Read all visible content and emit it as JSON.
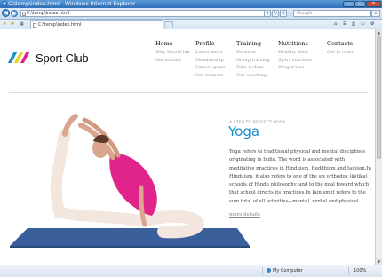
{
  "window": {
    "title": "C:\\temp\\index.html - Windows Internet Explorer",
    "minimize": "–",
    "maximize": "□",
    "close": "✕"
  },
  "addressbar": {
    "url": "C:\\temp\\index.html",
    "search_placeholder": "Google",
    "back": "◀",
    "forward": "▶"
  },
  "tabs": [
    {
      "label": "C:\\temp\\index.html"
    }
  ],
  "site": {
    "logo_text": "Sport Club",
    "logo_colors": [
      "#1a8fc9",
      "#e5d21c",
      "#e0248c"
    ],
    "accent": "#1a8fc9"
  },
  "nav": [
    {
      "label": "Home",
      "items": [
        "Why SportClub",
        "Get started"
      ]
    },
    {
      "label": "Profile",
      "items": [
        "Latest news",
        "Membership",
        "Fitness goals",
        "Our trainers"
      ]
    },
    {
      "label": "Training",
      "items": [
        "Personal",
        "Group training",
        "Take a class",
        "Our coaching"
      ]
    },
    {
      "label": "Nutritions",
      "items": [
        "Healthy diets",
        "Sport nutrition",
        "Weight loss"
      ]
    },
    {
      "label": "Contacts",
      "items": [
        "Get in touch"
      ]
    }
  ],
  "main": {
    "kicker": "A STEP TO PERFECT BODY",
    "heading": "Yoga",
    "body": "Yoga refers to traditional physical and mental disciplines originating in India. The word is associated with meditative practices in Hinduism, Buddhism and Jainism.In Hinduism, it also refers to one of the six orthodox (āstika) schools of Hindu philosophy, and to the goal toward which that school directs its practices.In Jainism it refers to the sum total of all activities—mental, verbal and physical.",
    "more_link": "more details"
  },
  "status": {
    "zone": "My Computer",
    "zoom": "100%"
  }
}
